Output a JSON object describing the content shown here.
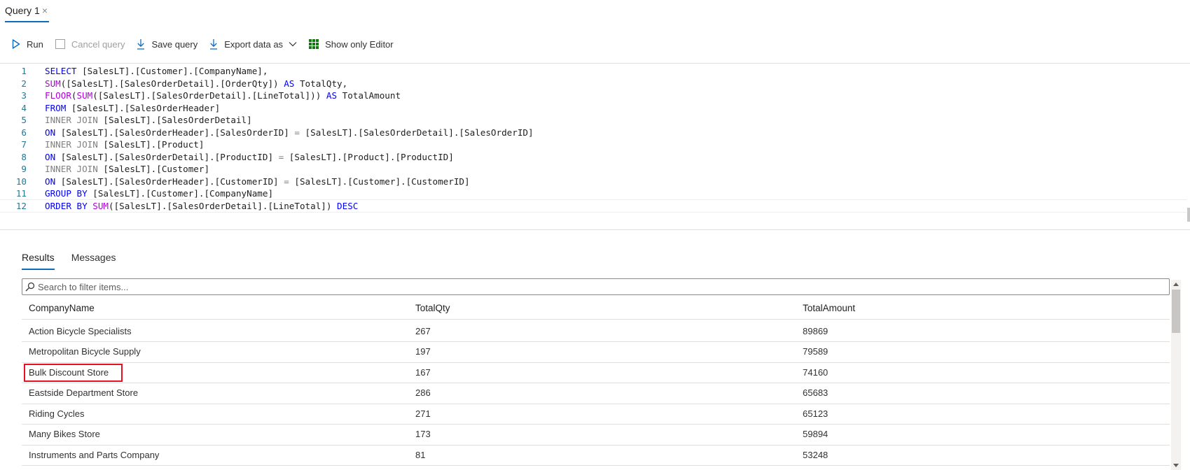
{
  "tab": {
    "title": "Query 1",
    "close_glyph": "×"
  },
  "toolbar": {
    "run": "Run",
    "cancel": "Cancel query",
    "save": "Save query",
    "export": "Export data as",
    "show_editor": "Show only Editor"
  },
  "editor": {
    "lines": [
      {
        "n": "1",
        "parts": [
          [
            "kw",
            "SELECT"
          ],
          [
            "t",
            " [SalesLT].[Customer].[CompanyName],"
          ]
        ]
      },
      {
        "n": "2",
        "parts": [
          [
            "fn",
            "SUM"
          ],
          [
            "t",
            "([SalesLT].[SalesOrderDetail].[OrderQty]) "
          ],
          [
            "kw",
            "AS"
          ],
          [
            "t",
            " TotalQty,"
          ]
        ]
      },
      {
        "n": "3",
        "parts": [
          [
            "fn",
            "FLOOR"
          ],
          [
            "t",
            "("
          ],
          [
            "fn",
            "SUM"
          ],
          [
            "t",
            "([SalesLT].[SalesOrderDetail].[LineTotal])) "
          ],
          [
            "kw",
            "AS"
          ],
          [
            "t",
            " TotalAmount"
          ]
        ]
      },
      {
        "n": "4",
        "parts": [
          [
            "kw",
            "FROM"
          ],
          [
            "t",
            " [SalesLT].[SalesOrderHeader]"
          ]
        ]
      },
      {
        "n": "5",
        "parts": [
          [
            "kw-gray",
            "INNER JOIN"
          ],
          [
            "t",
            " [SalesLT].[SalesOrderDetail]"
          ]
        ]
      },
      {
        "n": "6",
        "parts": [
          [
            "kw",
            "ON"
          ],
          [
            "t",
            " [SalesLT].[SalesOrderHeader].[SalesOrderID] "
          ],
          [
            "kw-gray",
            "="
          ],
          [
            "t",
            " [SalesLT].[SalesOrderDetail].[SalesOrderID]"
          ]
        ]
      },
      {
        "n": "7",
        "parts": [
          [
            "kw-gray",
            "INNER JOIN"
          ],
          [
            "t",
            " [SalesLT].[Product]"
          ]
        ]
      },
      {
        "n": "8",
        "parts": [
          [
            "kw",
            "ON"
          ],
          [
            "t",
            " [SalesLT].[SalesOrderDetail].[ProductID] "
          ],
          [
            "kw-gray",
            "="
          ],
          [
            "t",
            " [SalesLT].[Product].[ProductID]"
          ]
        ]
      },
      {
        "n": "9",
        "parts": [
          [
            "kw-gray",
            "INNER JOIN"
          ],
          [
            "t",
            " [SalesLT].[Customer]"
          ]
        ]
      },
      {
        "n": "10",
        "parts": [
          [
            "kw",
            "ON"
          ],
          [
            "t",
            " [SalesLT].[SalesOrderHeader].[CustomerID] "
          ],
          [
            "kw-gray",
            "="
          ],
          [
            "t",
            " [SalesLT].[Customer].[CustomerID]"
          ]
        ]
      },
      {
        "n": "11",
        "parts": [
          [
            "kw",
            "GROUP BY"
          ],
          [
            "t",
            " [SalesLT].[Customer].[CompanyName]"
          ]
        ]
      },
      {
        "n": "12",
        "parts": [
          [
            "kw",
            "ORDER BY"
          ],
          [
            "t",
            " "
          ],
          [
            "fn",
            "SUM"
          ],
          [
            "t",
            "([SalesLT].[SalesOrderDetail].[LineTotal]) "
          ],
          [
            "kw",
            "DESC"
          ]
        ]
      }
    ]
  },
  "results_tabs": {
    "results": "Results",
    "messages": "Messages"
  },
  "filter": {
    "placeholder": "Search to filter items..."
  },
  "grid": {
    "columns": [
      "CompanyName",
      "TotalQty",
      "TotalAmount"
    ],
    "rows": [
      [
        "Action Bicycle Specialists",
        "267",
        "89869"
      ],
      [
        "Metropolitan Bicycle Supply",
        "197",
        "79589"
      ],
      [
        "Bulk Discount Store",
        "167",
        "74160"
      ],
      [
        "Eastside Department Store",
        "286",
        "65683"
      ],
      [
        "Riding Cycles",
        "271",
        "65123"
      ],
      [
        "Many Bikes Store",
        "173",
        "59894"
      ],
      [
        "Instruments and Parts Company",
        "81",
        "53248"
      ]
    ],
    "highlighted_row": 2
  },
  "colors": {
    "accent": "#0f6cbd",
    "highlight": "#e81123",
    "keyword": "#0000ff",
    "function": "#af00db",
    "line_number": "#237893"
  }
}
